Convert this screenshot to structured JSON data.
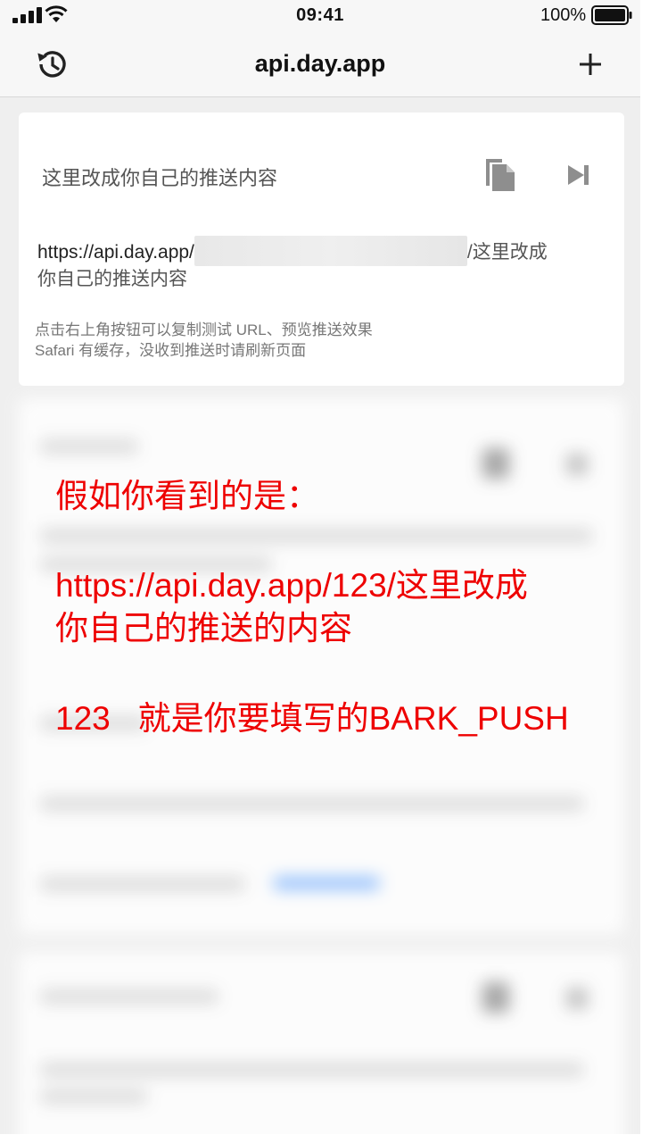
{
  "status_bar": {
    "time": "09:41",
    "battery": "100%",
    "icons": [
      "signal-icon",
      "wifi-icon",
      "battery-icon"
    ]
  },
  "nav": {
    "title": "api.day.app",
    "left_icon": "history-icon",
    "right_icon": "plus-icon"
  },
  "card": {
    "title": "这里改成你自己的推送内容",
    "url_prefix": "https://api.day.app/",
    "url_suffix_line1": "/这里改成",
    "url_suffix_line2": "你自己的推送内容",
    "hint_line1": "点击右上角按钮可以复制测试 URL、预览推送效果",
    "hint_line2": "Safari 有缓存，没收到推送时请刷新页面",
    "copy_icon": "copy-icon",
    "preview_icon": "skip-forward-icon"
  },
  "annotation": {
    "line1": "假如你看到的是：",
    "line2": "https://api.day.app/123/这里改成",
    "line3": "你自己的推送的内容",
    "line4": "123   就是你要填写的BARK_PUSH",
    "color": "#ee0000"
  }
}
